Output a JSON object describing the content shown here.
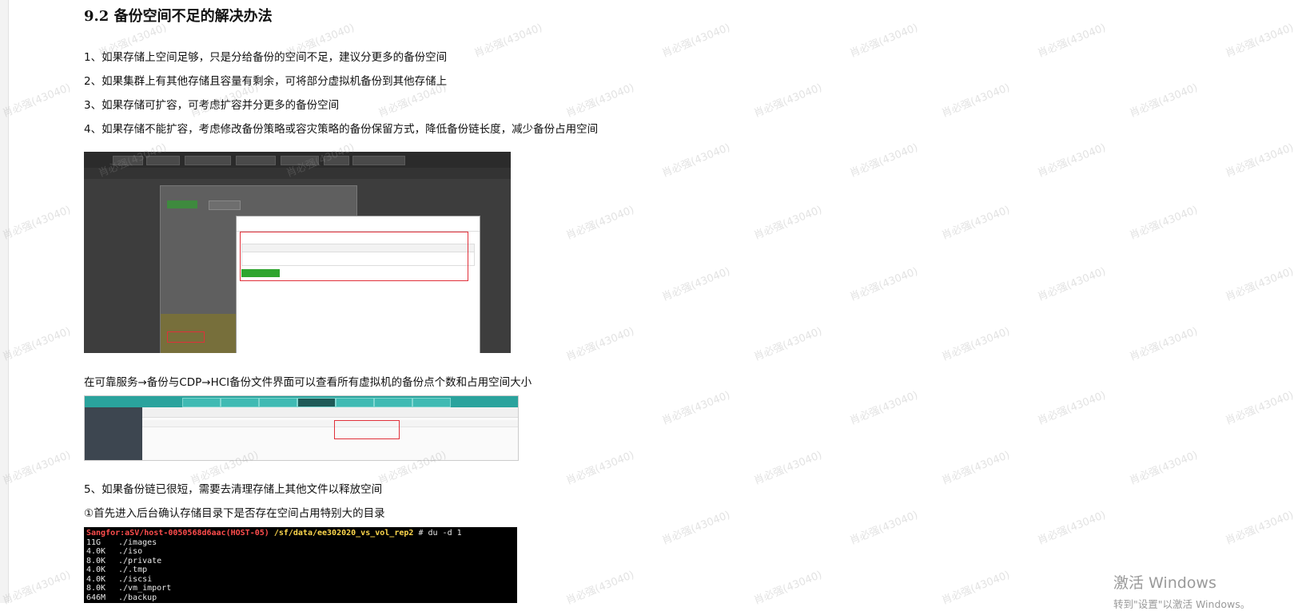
{
  "heading": "9.2 备份空间不足的解决办法",
  "paragraphs": {
    "p1": "1、如果存储上空间足够，只是分给备份的空间不足，建议分更多的备份空间",
    "p2": "2、如果集群上有其他存储且容量有剩余，可将部分虚拟机备份到其他存储上",
    "p3": "3、如果存储可扩容，可考虑扩容并分更多的备份空间",
    "p4": "4、如果存储不能扩容，考虑修改备份策略或容灾策略的备份保留方式，降低备份链长度，减少备份占用空间",
    "p5": "在可靠服务→备份与CDP→HCI备份文件界面可以查看所有虚拟机的备份点个数和占用空间大小",
    "p6": "5、如果备份链已很短，需要去清理存储上其他文件以释放空间",
    "p7": "①首先进入后台确认存储目录下是否存在空间占用特别大的目录"
  },
  "terminal": {
    "prompt_host": "Sangfor:aSV/host-0050568d6aac(HOST-05)",
    "prompt_path": "/sf/data/ee302020_vs_vol_rep2",
    "prompt_cmd": "# du -d 1",
    "rows": [
      {
        "size": "11G",
        "dir": "./images"
      },
      {
        "size": "4.0K",
        "dir": "./iso"
      },
      {
        "size": "8.0K",
        "dir": "./private"
      },
      {
        "size": "4.0K",
        "dir": "./.tmp"
      },
      {
        "size": "4.0K",
        "dir": "./iscsi"
      },
      {
        "size": "8.0K",
        "dir": "./vm_import"
      },
      {
        "size": "646M",
        "dir": "./backup"
      }
    ]
  },
  "watermark": "肖必强(43040)",
  "activation": {
    "line1": "激活 Windows",
    "line2": "转到\"设置\"以激活 Windows。"
  },
  "colors": {
    "terminal_host": "#ff4d4d",
    "terminal_path": "#ffd84d",
    "highlight_box": "#e0303a",
    "ui_teal": "#2aa39d"
  }
}
